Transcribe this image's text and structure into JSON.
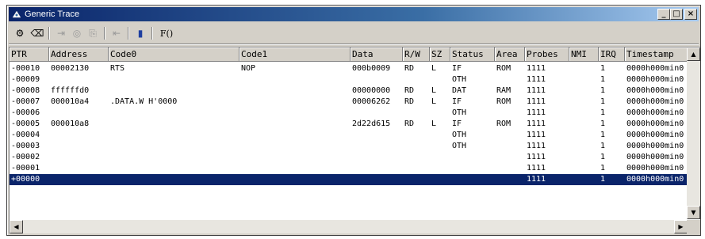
{
  "window": {
    "title": "Generic Trace",
    "minimize": "_",
    "maximize": "□",
    "close": "×"
  },
  "toolbar": {
    "items": [
      {
        "name": "trace-settings-icon",
        "glyph": "⚙"
      },
      {
        "name": "clear-icon",
        "glyph": "⌫"
      },
      {
        "name": "acquisition-icon",
        "glyph": "⇥"
      },
      {
        "name": "filter-icon",
        "glyph": "◎"
      },
      {
        "name": "copy-icon",
        "glyph": "⎘"
      },
      {
        "name": "find-icon",
        "glyph": "⇤"
      },
      {
        "name": "statistics-icon",
        "glyph": "▮"
      },
      {
        "name": "function-icon",
        "glyph": "F()"
      }
    ]
  },
  "table": {
    "columns": [
      "PTR",
      "Address",
      "Code0",
      "Code1",
      "Data",
      "R/W",
      "SZ",
      "Status",
      "Area",
      "Probes",
      "NMI",
      "IRQ",
      "Timestamp"
    ],
    "rows": [
      {
        "PTR": "-00010",
        "Address": "00002130",
        "Code0": "RTS",
        "Code1": "NOP",
        "Data": "000b0009",
        "RW": "RD",
        "SZ": "L",
        "Status": "IF",
        "Area": "ROM",
        "Probes": "1111",
        "NMI": "",
        "IRQ": "1",
        "Timestamp": "0000h000min0"
      },
      {
        "PTR": "-00009",
        "Address": "",
        "Code0": "",
        "Code1": "",
        "Data": "",
        "RW": "",
        "SZ": "",
        "Status": "OTH",
        "Area": "",
        "Probes": "1111",
        "NMI": "",
        "IRQ": "1",
        "Timestamp": "0000h000min0"
      },
      {
        "PTR": "-00008",
        "Address": "ffffffd0",
        "Code0": "",
        "Code1": "",
        "Data": "00000000",
        "RW": "RD",
        "SZ": "L",
        "Status": "DAT",
        "Area": "RAM",
        "Probes": "1111",
        "NMI": "",
        "IRQ": "1",
        "Timestamp": "0000h000min0"
      },
      {
        "PTR": "-00007",
        "Address": "000010a4",
        "Code0": ".DATA.W    H'0000",
        "Code1": "",
        "Data": "00006262",
        "RW": "RD",
        "SZ": "L",
        "Status": "IF",
        "Area": "ROM",
        "Probes": "1111",
        "NMI": "",
        "IRQ": "1",
        "Timestamp": "0000h000min0"
      },
      {
        "PTR": "-00006",
        "Address": "",
        "Code0": "",
        "Code1": "",
        "Data": "",
        "RW": "",
        "SZ": "",
        "Status": "OTH",
        "Area": "",
        "Probes": "1111",
        "NMI": "",
        "IRQ": "1",
        "Timestamp": "0000h000min0"
      },
      {
        "PTR": "-00005",
        "Address": "000010a8",
        "Code0": "",
        "Code1": "",
        "Data": "2d22d615",
        "RW": "RD",
        "SZ": "L",
        "Status": "IF",
        "Area": "ROM",
        "Probes": "1111",
        "NMI": "",
        "IRQ": "1",
        "Timestamp": "0000h000min0"
      },
      {
        "PTR": "-00004",
        "Address": "",
        "Code0": "",
        "Code1": "",
        "Data": "",
        "RW": "",
        "SZ": "",
        "Status": "OTH",
        "Area": "",
        "Probes": "1111",
        "NMI": "",
        "IRQ": "1",
        "Timestamp": "0000h000min0"
      },
      {
        "PTR": "-00003",
        "Address": "",
        "Code0": "",
        "Code1": "",
        "Data": "",
        "RW": "",
        "SZ": "",
        "Status": "OTH",
        "Area": "",
        "Probes": "1111",
        "NMI": "",
        "IRQ": "1",
        "Timestamp": "0000h000min0"
      },
      {
        "PTR": "-00002",
        "Address": "",
        "Code0": "",
        "Code1": "",
        "Data": "",
        "RW": "",
        "SZ": "",
        "Status": "",
        "Area": "",
        "Probes": "1111",
        "NMI": "",
        "IRQ": "1",
        "Timestamp": "0000h000min0"
      },
      {
        "PTR": "-00001",
        "Address": "",
        "Code0": "",
        "Code1": "",
        "Data": "",
        "RW": "",
        "SZ": "",
        "Status": "",
        "Area": "",
        "Probes": "1111",
        "NMI": "",
        "IRQ": "1",
        "Timestamp": "0000h000min0"
      },
      {
        "PTR": "+00000",
        "Address": "",
        "Code0": "",
        "Code1": "",
        "Data": "",
        "RW": "",
        "SZ": "",
        "Status": "",
        "Area": "",
        "Probes": "1111",
        "NMI": "",
        "IRQ": "1",
        "Timestamp": "0000h000min0",
        "selected": true
      }
    ]
  },
  "colors": {
    "titlebar_start": "#0a246a",
    "titlebar_end": "#a6caf0",
    "selection": "#0a246a",
    "face": "#d4d0c8"
  }
}
